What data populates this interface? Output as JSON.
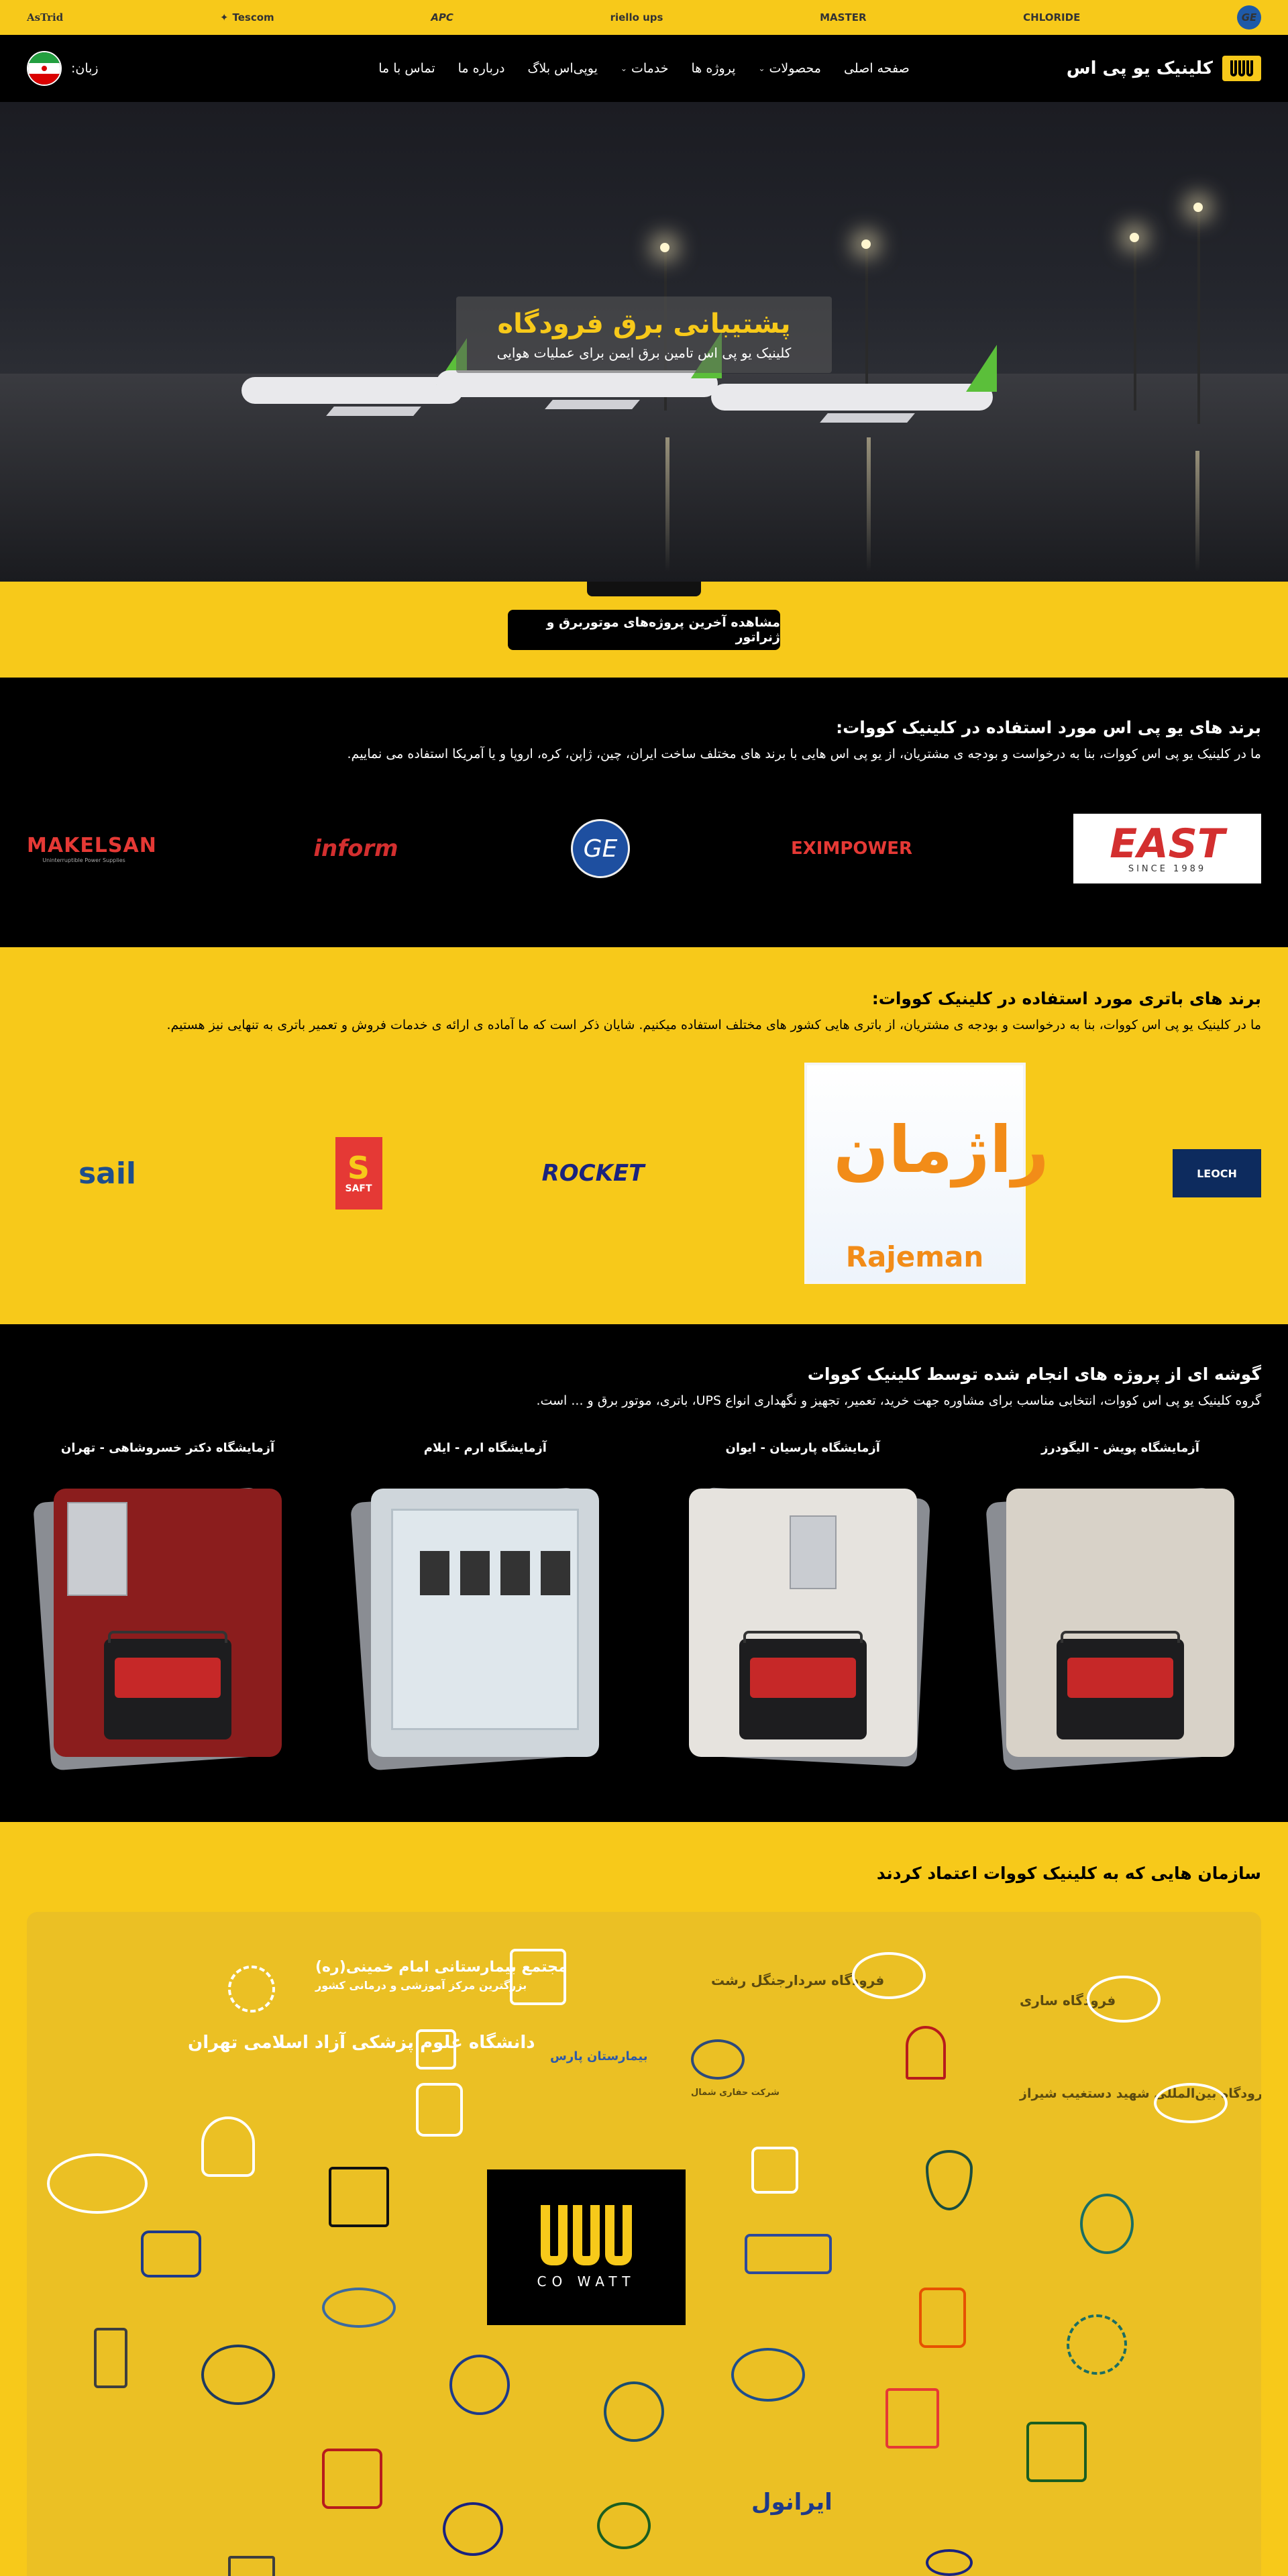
{
  "brand_strip": {
    "items": [
      "AsTrid",
      "Tescom",
      "APC",
      "riello ups",
      "MASTER",
      "CHLORIDE",
      "GE"
    ]
  },
  "header": {
    "logo_text": "کلینیک یو پی اس",
    "nav": [
      {
        "label": "صفحه اصلی",
        "has_dropdown": false
      },
      {
        "label": "محصولات",
        "has_dropdown": true
      },
      {
        "label": "پروژه ها",
        "has_dropdown": false
      },
      {
        "label": "خدمات",
        "has_dropdown": true
      },
      {
        "label": "یوپی‌اس بلاگ",
        "has_dropdown": false
      },
      {
        "label": "درباره ما",
        "has_dropdown": false
      },
      {
        "label": "تماس با ما",
        "has_dropdown": false
      }
    ],
    "language_label": "زبان:"
  },
  "hero": {
    "title": "پشتیبانی برق فرودگاه",
    "subtitle": "کلینیک یو پی اس تامین برق ایمن برای عملیات هوایی"
  },
  "cta": {
    "button_label": "مشاهده آخرین پروژه‌های موتوربرق و ژنراتور"
  },
  "ups_brands": {
    "title": "برند های یو پی اس مورد استفاده در کلینیک کووات:",
    "description": "ما در کلینیک یو پی اس کووات، بنا به درخواست و بودجه ی مشتریان، از یو پی اس هایی با برند های مختلف ساخت ایران، چین، ژاپن، کره، اروپا و یا آمریکا استفاده می نماییم.",
    "logos": {
      "makelsan": "MAKELSAN",
      "makelsan_sub": "Uninterruptible Power Supplies",
      "inform": "inform",
      "ge": "GE",
      "eximpower": "EXIMPOWER",
      "east": "EAST",
      "east_sub": "SINCE 1989"
    }
  },
  "battery_brands": {
    "title": "برند های باتری مورد استفاده در کلینیک کووات:",
    "description": "ما در کلینیک یو پی اس کووات، بنا به درخواست و بودجه ی مشتریان، از باتری هایی کشور های مختلف استفاده میکنیم. شایان ذکر است که ما آماده ی ارائه ی خدمات فروش و تعمیر باتری به تنهایی نیز هستیم.",
    "logos": {
      "sail": "sail",
      "saft": "SAFT",
      "rocket": "ROCKET",
      "rajeman_fa": "راژمان",
      "rajeman_en": "Rajeman",
      "leoch": "LEOCH"
    }
  },
  "projects": {
    "title": "گوشه ای از پروژه های انجام شده توسط کلینیک کووات",
    "description": "گروه کلینیک یو پی اس کووات، انتخابی مناسب برای مشاوره جهت خرید، تعمیر، تجهیز و نگهداری انواع UPS، باتری، موتور برق و ... است.",
    "items": [
      {
        "title": "آزمایشگاه پویش - الیگودرز"
      },
      {
        "title": "آزمایشگاه پارسیان - ایوان"
      },
      {
        "title": "آزمایشگاه ارم - ایلام"
      },
      {
        "title": "آزمایشگاه دکتر خسروشاهی - تهران"
      }
    ]
  },
  "clients": {
    "title": "سازمان هایی که به کلینیک کووات اعتماد کردند",
    "labels": {
      "rasht": "فرودگاه سردارجنگل رشت",
      "sari": "فرودگاه ساری",
      "shiraz": "فرودگاه بین‌المللی شهید دستغیب شیراز",
      "khomeini": "مجتمع بیمارستانی امام خمینی(ره)",
      "khomeini_sub": "بزرگترین مرکز آموزشی و درمانی کشور",
      "azad": "دانشگاه علوم پزشکی آزاد اسلامی تهران",
      "pars": "بیمارستان پارس",
      "north": "شرکت حفاری شمال",
      "center_text": "CO WATT",
      "iranol": "ایرانول"
    }
  },
  "colors": {
    "brand_yellow": "#f7c91a",
    "black": "#000000"
  }
}
